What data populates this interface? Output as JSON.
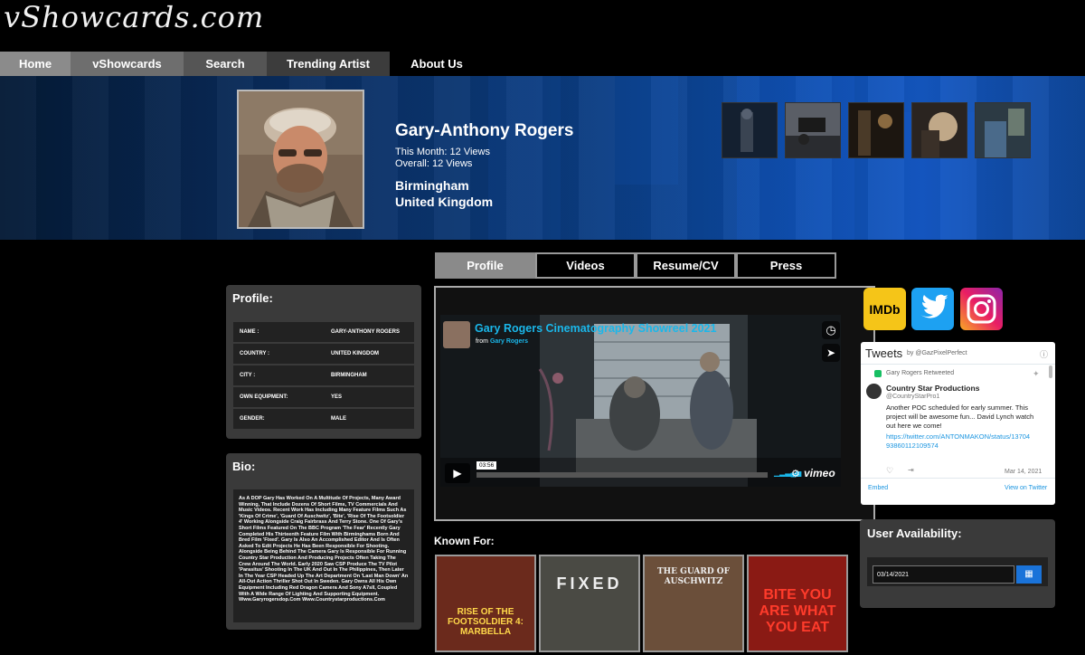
{
  "site": {
    "logo": "vShowcards.com"
  },
  "nav": [
    {
      "label": "Home",
      "bg": "#8b8b8b",
      "width": 78
    },
    {
      "label": "vShowcards",
      "bg": "#6e6e6e",
      "width": 125
    },
    {
      "label": "Search",
      "bg": "#555555",
      "width": 92
    },
    {
      "label": "Trending Artist",
      "bg": "#3c3c3c",
      "width": 136
    },
    {
      "label": "About Us",
      "bg": "#000000",
      "width": 104
    }
  ],
  "artist": {
    "name": "Gary-Anthony Rogers",
    "views_month": "This Month: 12 Views",
    "views_overall": "Overall: 12 Views",
    "city": "Birmingham",
    "country": "United Kingdom"
  },
  "tabs": [
    "Profile",
    "Videos",
    "Resume/CV",
    "Press"
  ],
  "profile": {
    "title": "Profile:",
    "rows": [
      {
        "k": "NAME :",
        "v": "GARY-ANTHONY ROGERS"
      },
      {
        "k": "COUNTRY :",
        "v": "UNITED KINGDOM"
      },
      {
        "k": "CITY :",
        "v": "BIRMINGHAM"
      },
      {
        "k": "OWN EQUIPMENT:",
        "v": "YES"
      },
      {
        "k": "GENDER:",
        "v": "MALE"
      }
    ]
  },
  "bio": {
    "title": "Bio:",
    "text": "As A DOP Gary Has Worked On A Multitude Of Projects, Many Award Winning, That Include Dozens Of Short Films, TV Commercials And Music Videos. Recent Work Has Including Many Feature Films Such As 'Kings Of Crime', 'Guard Of Auschwitz', 'Bite', 'Rise Of The Footsoldier 4' Working Alongside Craig Fairbrass And Terry Stone. One Of Gary's Short Films Featured On The BBC Program 'The Fear' Recently Gary Completed His Thirteenth Feature Film With Birminghams Born And Bred Film 'Fixed'. Gary Is Also An Accomplished Editor And Is Often Asked To Edit Projects He Has Been Responsible For Shooting. Alongside Being Behind The Camera Gary Is Responsible For Running Country Star Production And Producing Projects Often Taking The Crew Around The World. Early 2020 Saw CSP Produce The TV Pilot 'Parasitus' Shooting In The UK And Out In The Philippines, Then Later In The Year CSP Headed Up The Art Department On 'Last Man Down' An All-Out Action Thriller Shot Out In Sweden. Gary Owns All His Own Equipment Including Red Dragon Camera And Sony A7sII, Coupled With A Wide Range Of Lighting And Supporting Equipment. Www.Garyrogersdop.Com Www.Countrystarproductions.Com"
  },
  "video": {
    "title": "Gary Rogers Cinematography Showreel 2021",
    "from_prefix": "from",
    "from_name": "Gary Rogers",
    "time": "03:56",
    "brand": "vimeo"
  },
  "known_for": {
    "title": "Known For:",
    "posters": [
      {
        "title": "RISE OF THE FOOTSOLDIER 4: MARBELLA",
        "bg": "#6b2a1c"
      },
      {
        "title": "FIXED",
        "bg": "#4a4a44"
      },
      {
        "title": "THE GUARD OF AUSCHWITZ",
        "bg": "#6b4f3a"
      },
      {
        "title": "BITE YOU ARE WHAT YOU EAT",
        "bg": "#8a1a14"
      }
    ]
  },
  "social": [
    {
      "name": "imdb-icon",
      "label": "IMDb",
      "bg": "#f5c518",
      "fg": "#000"
    },
    {
      "name": "twitter-icon",
      "label": "",
      "bg": "#1da1f2",
      "fg": "#fff"
    },
    {
      "name": "instagram-icon",
      "label": "",
      "bg": "#c13584",
      "fg": "#fff"
    }
  ],
  "tweets": {
    "title": "Tweets",
    "by": "by @GazPixelPerfect",
    "retweet": "Gary Rogers Retweeted",
    "account": "Country Star Productions",
    "handle": "@CountryStarPro1",
    "body": "Another POC scheduled for early summer. This project will be awesome fun... David Lynch watch out here we come!",
    "link": "https://twitter.com/ANTONMAKON/status/1370493860112109574",
    "date": "Mar 14, 2021",
    "embed": "Embed",
    "view": "View on Twitter"
  },
  "availability": {
    "title": "User Availability:",
    "date": "03/14/2021"
  },
  "colors": {
    "accent": "#1a73d9",
    "panel": "#3a3a3a",
    "link": "#1b95e0"
  }
}
